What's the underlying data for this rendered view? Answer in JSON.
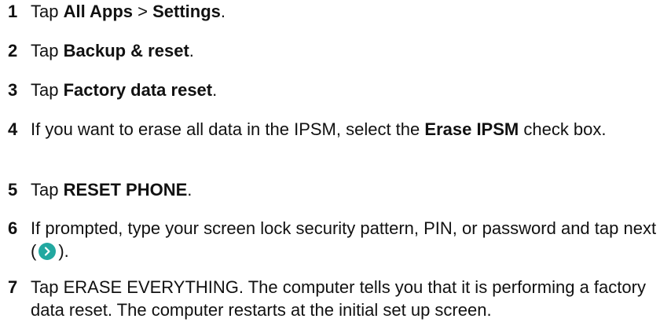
{
  "steps": [
    {
      "number": "1",
      "prefix": "Tap ",
      "bold1": "All Apps",
      "middle": " > ",
      "bold2": "Settings",
      "suffix": "."
    },
    {
      "number": "2",
      "prefix": "Tap ",
      "bold": "Backup & reset",
      "suffix": "."
    },
    {
      "number": "3",
      "prefix": "Tap ",
      "bold": "Factory data reset",
      "suffix": "."
    },
    {
      "number": "4",
      "prefix": "If you want to erase all data in the IPSM, select the ",
      "bold": "Erase IPSM",
      "suffix": " check box."
    },
    {
      "number": "5",
      "prefix": "Tap ",
      "bold": "RESET PHONE",
      "suffix": "."
    },
    {
      "number": "6",
      "prefix": "If prompted, type your screen lock security pattern, PIN, or password and tap next (",
      "icon": "next-arrow-icon",
      "suffix": ")."
    },
    {
      "number": "7",
      "text": "Tap ERASE EVERYTHING. The computer tells you that it is performing a factory data reset. The computer restarts at the initial set up screen."
    }
  ],
  "colors": {
    "text": "#111111",
    "next_icon_bg": "#22a8a0"
  }
}
